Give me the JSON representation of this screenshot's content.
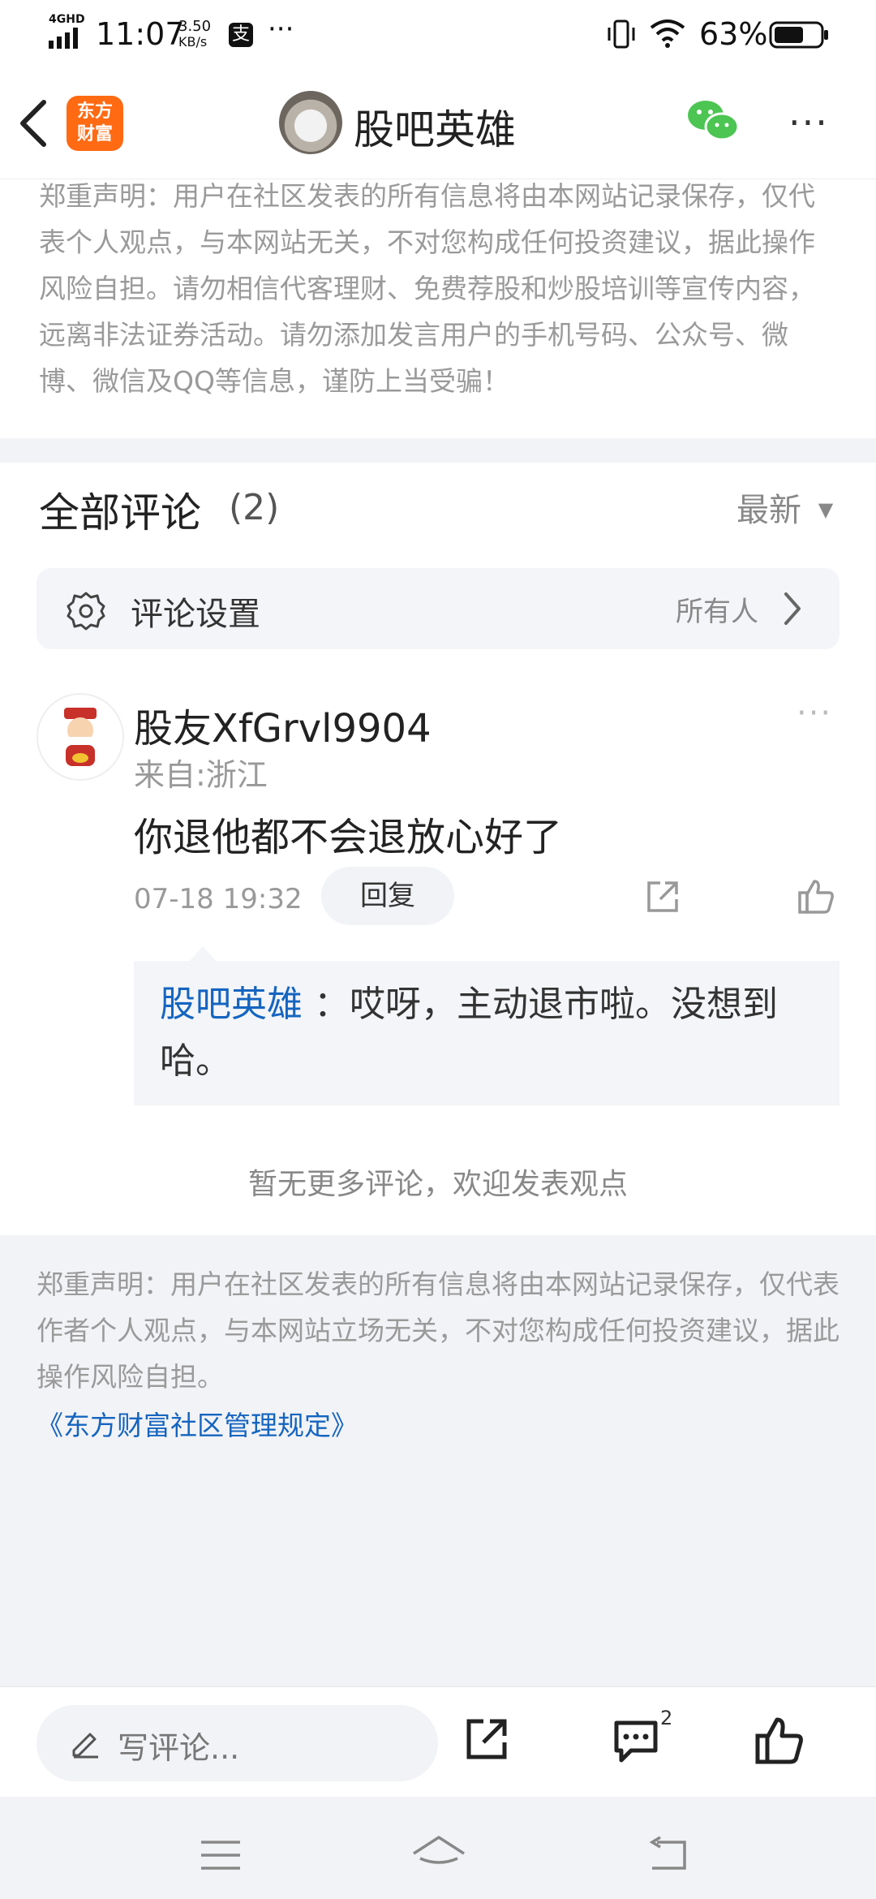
{
  "status_bar": {
    "network": "4GHD",
    "time": "11:07",
    "speed_value": "3.50",
    "speed_unit": "KB/s",
    "battery": "63%"
  },
  "header": {
    "logo_line1": "东方",
    "logo_line2": "财富",
    "title": "股吧英雄"
  },
  "disclaimer_top": "郑重声明：用户在社区发表的所有信息将由本网站记录保存，仅代表个人观点，与本网站无关，不对您构成任何投资建议，据此操作风险自担。请勿相信代客理财、免费荐股和炒股培训等宣传内容，远离非法证券活动。请勿添加发言用户的手机号码、公众号、微博、微信及QQ等信息，谨防上当受骗！",
  "comments_section": {
    "title": "全部评论",
    "count": "(2)",
    "sort_label": "最新",
    "settings_label": "评论设置",
    "settings_value": "所有人"
  },
  "comment": {
    "username": "股友XfGrvl9904",
    "location": "来自:浙江",
    "content": "你退他都不会退放心好了",
    "timestamp": "07-18 19:32",
    "reply_button": "回复",
    "reply": {
      "author": "股吧英雄",
      "text_line1": "：哎呀，主动退市啦。没想到",
      "text_line2": "哈。"
    }
  },
  "no_more_text": "暂无更多评论，欢迎发表观点",
  "footer": {
    "disclaimer": "郑重声明：用户在社区发表的所有信息将由本网站记录保存，仅代表作者个人观点，与本网站立场无关，不对您构成任何投资建议，据此操作风险自担。",
    "rules_link": "《东方财富社区管理规定》"
  },
  "bottom_bar": {
    "comment_placeholder": "写评论...",
    "comment_badge": "2"
  },
  "colors": {
    "brand_orange": "#ff6a13",
    "link_blue": "#1565c0",
    "wechat_green": "#4cc552"
  }
}
